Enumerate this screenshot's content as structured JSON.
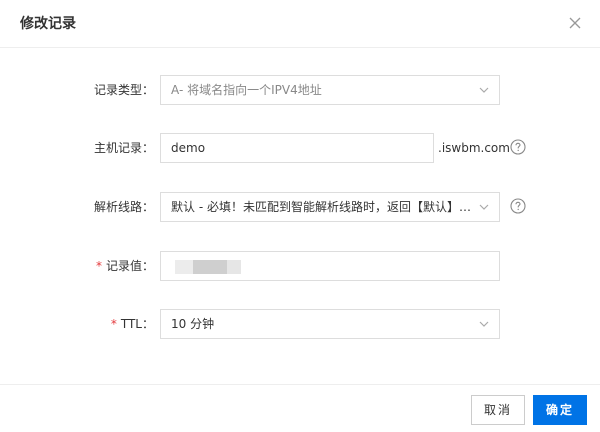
{
  "dialog": {
    "title": "修改记录"
  },
  "form": {
    "record_type": {
      "label": "记录类型：",
      "value": "A- 将域名指向一个IPV4地址"
    },
    "host": {
      "label": "主机记录：",
      "value": "demo",
      "suffix": ".iswbm.com"
    },
    "line": {
      "label": "解析线路：",
      "value": "默认 - 必填！未匹配到智能解析线路时，返回【默认】线路设置结果"
    },
    "record_value": {
      "required_mark": "*",
      "label": "记录值："
    },
    "ttl": {
      "required_mark": "*",
      "label": "TTL：",
      "value": "10 分钟"
    }
  },
  "footer": {
    "cancel_label": "取消",
    "ok_label": "确定"
  }
}
